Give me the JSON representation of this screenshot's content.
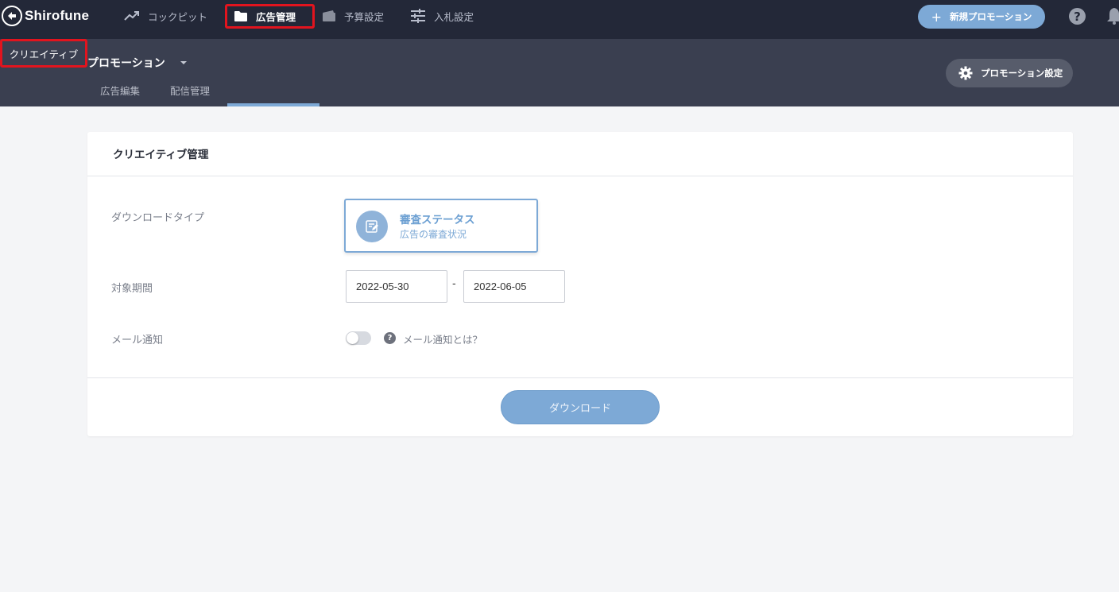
{
  "app": {
    "logo_text": "Shirofune"
  },
  "topnav": {
    "items": [
      {
        "label": "コックピット",
        "icon": "trending-up-icon"
      },
      {
        "label": "広告管理",
        "icon": "folder-icon",
        "active": true
      },
      {
        "label": "予算設定",
        "icon": "wallet-icon"
      },
      {
        "label": "入札設定",
        "icon": "sliders-icon"
      }
    ],
    "new_promotion_label": "新規プロモーション",
    "help_symbol": "?"
  },
  "subheader": {
    "promotion_title": "プロモーション",
    "tabs": [
      {
        "label": "広告編集"
      },
      {
        "label": "配信管理"
      },
      {
        "label": "クリエイティブ",
        "active": true
      }
    ],
    "settings_label": "プロモーション設定"
  },
  "card": {
    "title": "クリエイティブ管理",
    "download_type_label": "ダウンロードタイプ",
    "download_type": {
      "name": "審査ステータス",
      "description": "広告の審査状況"
    },
    "period_label": "対象期間",
    "period_start": "2022-05-30",
    "period_separator": "-",
    "period_end": "2022-06-05",
    "mail_label": "メール通知",
    "mail_enabled": false,
    "mail_help_symbol": "?",
    "mail_help_text": "メール通知とは？",
    "download_button_label": "ダウンロード"
  },
  "colors": {
    "topbar_bg": "#232838",
    "subheader_bg": "#3a3f50",
    "accent": "#7da9d6",
    "highlight_border": "#e2141e"
  }
}
